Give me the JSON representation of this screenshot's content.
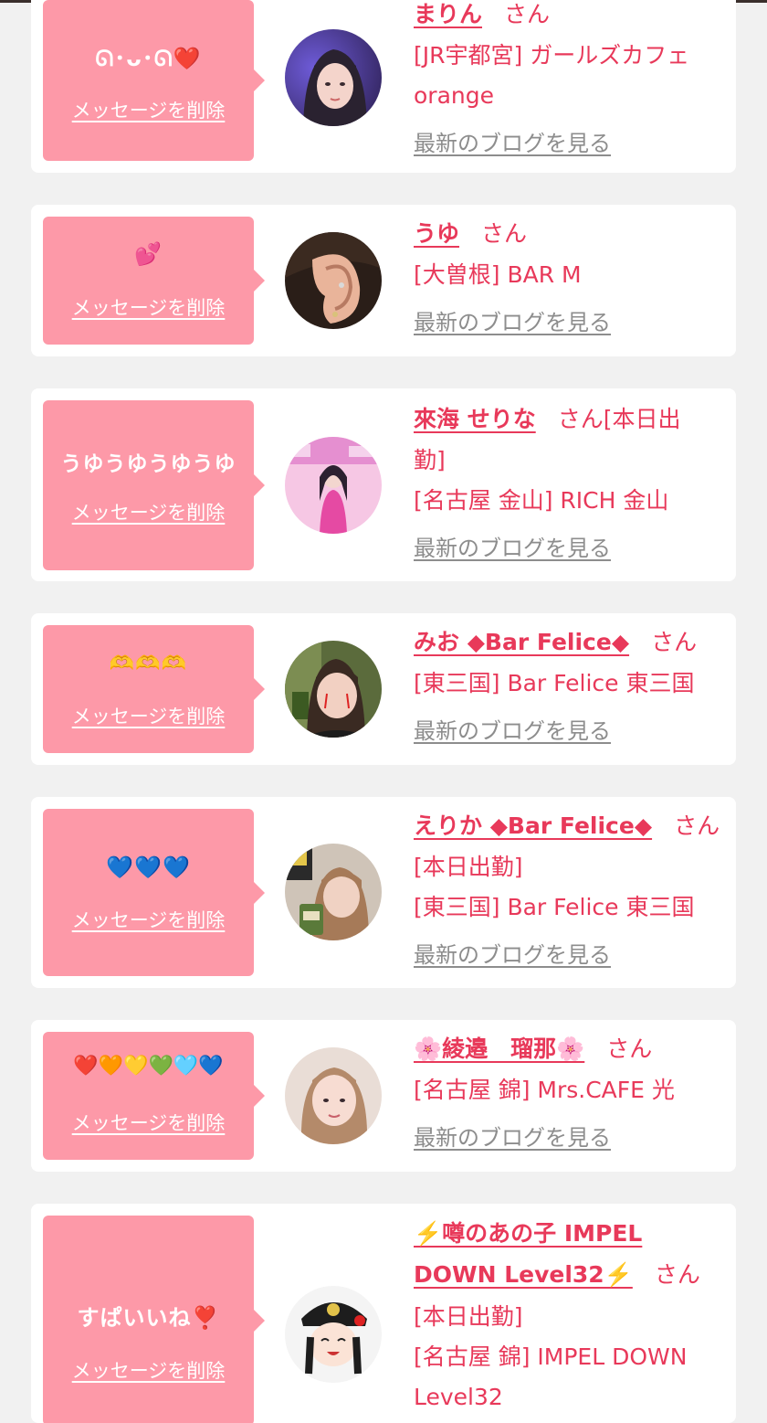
{
  "common": {
    "delete_label": "メッセージを削除",
    "blog_label": "最新のブログを見る",
    "san_label": "さん"
  },
  "cards": [
    {
      "message": "ᘏ･ᴗ･ᘏ❤️",
      "name": "まりん",
      "lines": [
        "[JR宇都宮] ガールズカフェ",
        "orange"
      ]
    },
    {
      "message": "💕",
      "name": "うゆ",
      "lines": [
        "[大曽根] BAR M"
      ]
    },
    {
      "message": "うゆうゆうゆうゆ",
      "name": "來海 せりな",
      "name_suffix": "さん[本日出",
      "lines": [
        "勤]",
        "[名古屋 金山] RICH 金山"
      ]
    },
    {
      "message": "🫶🫶🫶",
      "name": "みお ◆Bar Felice◆",
      "lines": [
        "[東三国] Bar Felice 東三国"
      ]
    },
    {
      "message": "💙💙💙",
      "name": "えりか ◆Bar Felice◆",
      "lines": [
        "[本日出勤]",
        "[東三国] Bar Felice 東三国"
      ]
    },
    {
      "message": "❤️🧡💛💚🩵💙",
      "name": "🌸綾邉　瑠那🌸",
      "lines": [
        "[名古屋 錦] Mrs.CAFE 光"
      ]
    },
    {
      "message": "すぱいいね❣️",
      "name_line1": "⚡️噂のあの子 IMPEL",
      "name_line2": "DOWN Level32⚡️",
      "lines": [
        "[本日出勤]",
        "[名古屋 錦] IMPEL DOWN",
        "Level32"
      ]
    }
  ],
  "colors": {
    "bubble": "#fd99a8",
    "accent": "#e8395a",
    "muted": "#8d8d8d",
    "background": "#f1f1f1"
  },
  "icons": [
    "hearts-emoji",
    "avatar-photo"
  ]
}
